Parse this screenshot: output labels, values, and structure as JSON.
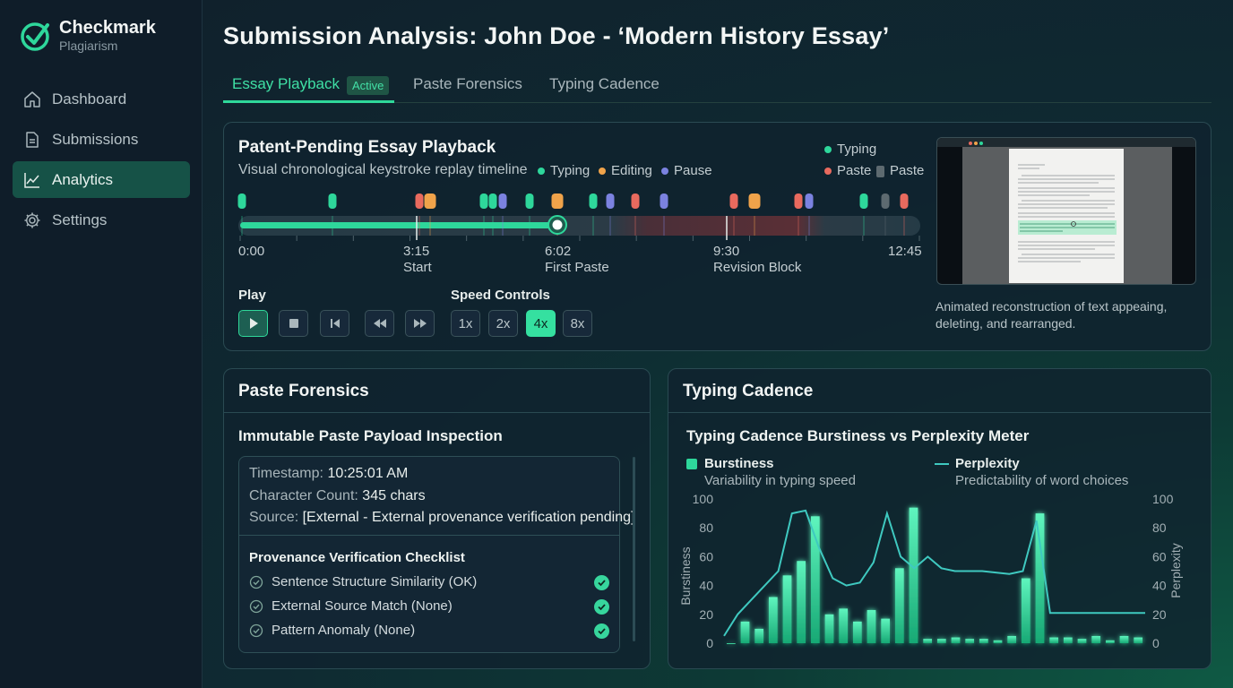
{
  "brand": {
    "name": "Checkmark",
    "sub": "Plagiarism"
  },
  "nav": [
    {
      "label": "Dashboard",
      "icon": "home-icon"
    },
    {
      "label": "Submissions",
      "icon": "document-icon"
    },
    {
      "label": "Analytics",
      "icon": "chart-line-icon",
      "active": true
    },
    {
      "label": "Settings",
      "icon": "gear-icon"
    }
  ],
  "page": {
    "title": "Submission Analysis: John Doe - ‘Modern History Essay’"
  },
  "tabs": [
    {
      "label": "Essay Playback",
      "badge": "Active",
      "active": true
    },
    {
      "label": "Paste Forensics"
    },
    {
      "label": "Typing Cadence"
    }
  ],
  "playback": {
    "title": "Patent-Pending Essay Playback",
    "subtitle": "Visual chronological keystroke replay timeline",
    "legend": {
      "typing": "Typing",
      "editing": "Editing",
      "pause": "Pause"
    },
    "legend_right": {
      "typing": "Typing",
      "paste": "Paste",
      "paste2": "Paste"
    },
    "timeline": {
      "times": [
        "0:00",
        "3:15",
        "6:02",
        "9:30",
        "12:45"
      ],
      "marker_labels": [
        "Start",
        "First Paste",
        "Revision Block"
      ],
      "progress": 0.466
    },
    "play_label": "Play",
    "speed_label": "Speed Controls",
    "speeds": [
      "1x",
      "2x",
      "4x",
      "8x"
    ],
    "active_speed": "4x",
    "caption": "Animated reconstruction of text appeaing, deleting, and rearranged."
  },
  "colors": {
    "typing": "#2ed79b",
    "editing": "#f0a34a",
    "pause": "#7b82e0",
    "paste": "#e86a5e",
    "paste_gray": "#5d6a70"
  },
  "forensics": {
    "title": "Paste Forensics",
    "subtitle": "Immutable Paste Payload Inspection",
    "timestamp_label": "Timestamp:",
    "timestamp": "10:25:01 AM",
    "count_label": "Character Count:",
    "count": "345 chars",
    "source_label": "Source:",
    "source": "[External - External provenance verification pending]",
    "checklist_title": "Provenance Verification Checklist",
    "checklist": [
      "Sentence Structure Similarity (OK)",
      "External Source Match (None)",
      "Pattern Anomaly (None)"
    ]
  },
  "cadence": {
    "title": "Typing Cadence",
    "chart_title": "Typing Cadence Burstiness vs Perplexity Meter",
    "burst_label": "Burstiness",
    "burst_desc": "Variability in typing speed",
    "perp_label": "Perplexity",
    "perp_desc": "Predictability of word choices"
  },
  "chart_data": {
    "type": "bar",
    "title": "Typing Cadence Burstiness vs Perplexity Meter",
    "ylabel": "Burstiness",
    "y2label": "Perplexity",
    "ylim": [
      0,
      100
    ],
    "yticks": [
      0,
      20,
      40,
      60,
      80,
      100
    ],
    "series": [
      {
        "name": "Burstiness",
        "type": "bar",
        "values": [
          0,
          15,
          10,
          32,
          47,
          57,
          88,
          20,
          24,
          15,
          23,
          17,
          52,
          94,
          3,
          3,
          4,
          3,
          3,
          2,
          5,
          45,
          90,
          4,
          4,
          3,
          5,
          2,
          5,
          4
        ]
      },
      {
        "name": "Perplexity",
        "type": "line",
        "values": [
          5,
          20,
          30,
          40,
          50,
          90,
          92,
          66,
          45,
          40,
          42,
          56,
          90,
          60,
          52,
          60,
          52,
          50,
          50,
          50,
          49,
          48,
          50,
          85,
          21,
          21,
          21,
          21,
          21,
          21,
          21,
          21
        ]
      }
    ]
  }
}
